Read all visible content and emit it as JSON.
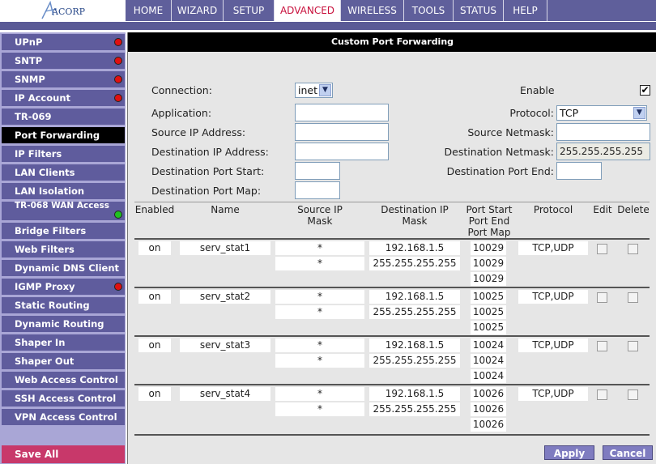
{
  "logo": {
    "text": "ACORP"
  },
  "nav": [
    "HOME",
    "WIZARD",
    "SETUP",
    "ADVANCED",
    "WIRELESS",
    "TOOLS",
    "STATUS",
    "HELP"
  ],
  "sidebar": {
    "items": [
      {
        "label": "UPnP",
        "status": "red"
      },
      {
        "label": "SNTP",
        "status": "red"
      },
      {
        "label": "SNMP",
        "status": "red"
      },
      {
        "label": "IP Account",
        "status": "red"
      },
      {
        "label": "TR-069",
        "status": ""
      },
      {
        "label": "Port Forwarding",
        "status": "",
        "active": true
      },
      {
        "label": "IP Filters",
        "status": ""
      },
      {
        "label": "LAN Clients",
        "status": ""
      },
      {
        "label": "LAN Isolation",
        "status": ""
      },
      {
        "label": "TR-068 WAN Access",
        "status": "green"
      },
      {
        "label": "Bridge Filters",
        "status": ""
      },
      {
        "label": "Web Filters",
        "status": ""
      },
      {
        "label": "Dynamic DNS Client",
        "status": ""
      },
      {
        "label": "IGMP Proxy",
        "status": "red"
      },
      {
        "label": "Static Routing",
        "status": ""
      },
      {
        "label": "Dynamic Routing",
        "status": ""
      },
      {
        "label": "Shaper In",
        "status": ""
      },
      {
        "label": "Shaper Out",
        "status": ""
      },
      {
        "label": "Web Access Control",
        "status": ""
      },
      {
        "label": "SSH Access Control",
        "status": ""
      },
      {
        "label": "VPN Access Control",
        "status": ""
      }
    ],
    "save_all": "Save All"
  },
  "page": {
    "title": "Custom Port Forwarding",
    "form": {
      "connection_label": "Connection:",
      "connection_value": "inet",
      "enable_label": "Enable",
      "enable_checked": "✔",
      "application_label": "Application:",
      "application_value": "",
      "protocol_label": "Protocol:",
      "protocol_value": "TCP",
      "source_ip_label": "Source IP Address:",
      "source_ip_value": "",
      "source_netmask_label": "Source Netmask:",
      "source_netmask_value": "",
      "dest_ip_label": "Destination IP Address:",
      "dest_ip_value": "",
      "dest_netmask_label": "Destination Netmask:",
      "dest_netmask_value": "255.255.255.255",
      "dest_port_start_label": "Destination Port Start:",
      "dest_port_start_value": "",
      "dest_port_end_label": "Destination Port End:",
      "dest_port_end_value": "",
      "dest_port_map_label": "Destination Port Map:",
      "dest_port_map_value": ""
    },
    "table": {
      "headers": {
        "enabled": "Enabled",
        "name": "Name",
        "src_mask_1": "Source IP",
        "src_mask_2": "Mask",
        "dst_mask_1": "Destination IP",
        "dst_mask_2": "Mask",
        "ports_1": "Port Start",
        "ports_2": "Port End",
        "ports_3": "Port Map",
        "protocol": "Protocol",
        "edit": "Edit",
        "delete": "Delete"
      },
      "rows": [
        {
          "enabled": "on",
          "name": "serv_stat1",
          "src_ip": "*",
          "src_mask": "*",
          "dst_ip": "192.168.1.5",
          "dst_mask": "255.255.255.255",
          "port_start": "10029",
          "port_end": "10029",
          "port_map": "10029",
          "protocol": "TCP,UDP"
        },
        {
          "enabled": "on",
          "name": "serv_stat2",
          "src_ip": "*",
          "src_mask": "*",
          "dst_ip": "192.168.1.5",
          "dst_mask": "255.255.255.255",
          "port_start": "10025",
          "port_end": "10025",
          "port_map": "10025",
          "protocol": "TCP,UDP"
        },
        {
          "enabled": "on",
          "name": "serv_stat3",
          "src_ip": "*",
          "src_mask": "*",
          "dst_ip": "192.168.1.5",
          "dst_mask": "255.255.255.255",
          "port_start": "10024",
          "port_end": "10024",
          "port_map": "10024",
          "protocol": "TCP,UDP"
        },
        {
          "enabled": "on",
          "name": "serv_stat4",
          "src_ip": "*",
          "src_mask": "*",
          "dst_ip": "192.168.1.5",
          "dst_mask": "255.255.255.255",
          "port_start": "10026",
          "port_end": "10026",
          "port_map": "10026",
          "protocol": "TCP,UDP"
        }
      ]
    },
    "buttons": {
      "apply": "Apply",
      "cancel": "Cancel"
    }
  },
  "colors": {
    "nav_bg": "#5f5f9b",
    "active_tab_text": "#c8103c",
    "sidebar_bg": "#a9a6d6",
    "sidebar_item": "#5f5c9d",
    "save_all": "#c8386a"
  }
}
